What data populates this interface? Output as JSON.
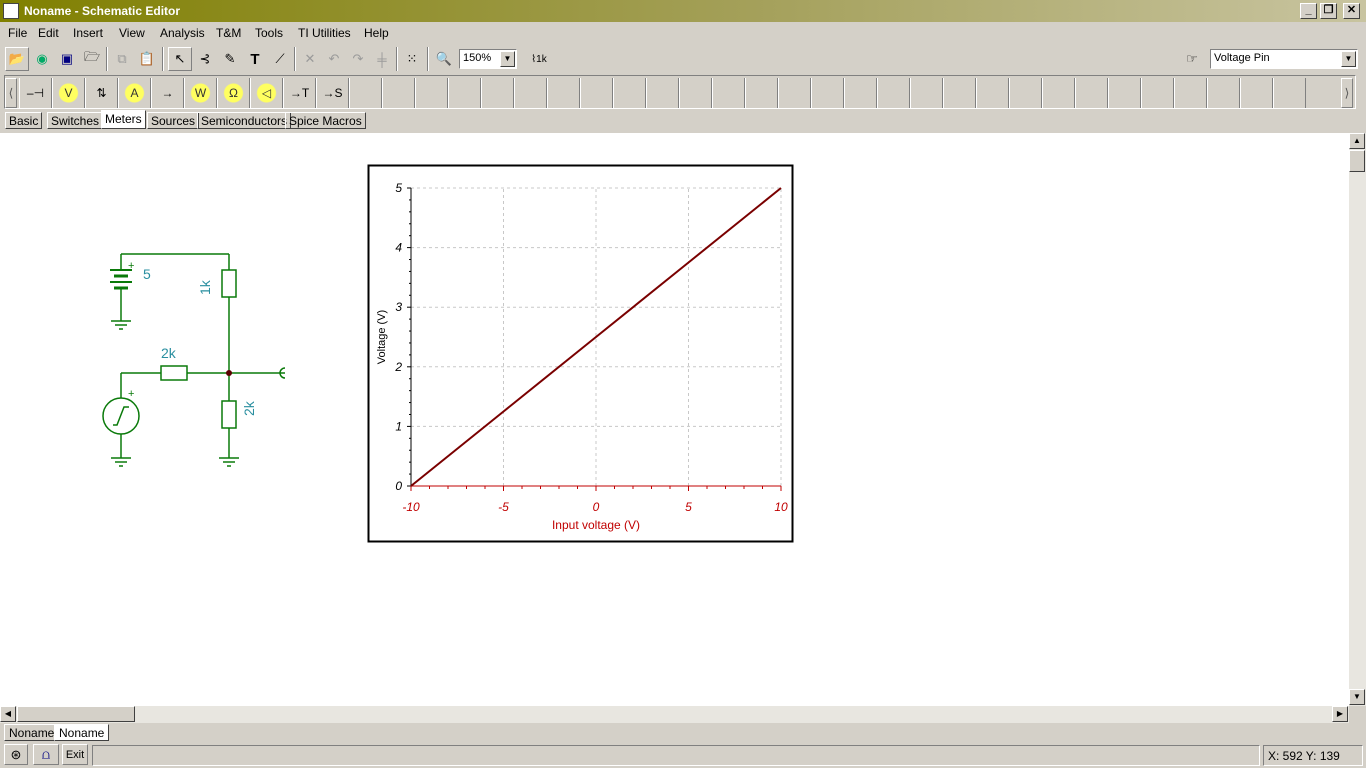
{
  "window": {
    "title": "Noname - Schematic Editor"
  },
  "menu": [
    "File",
    "Edit",
    "Insert",
    "View",
    "Analysis",
    "T&M",
    "Tools",
    "TI Utilities",
    "Help"
  ],
  "toolbar": {
    "zoom_value": "150%",
    "component_select": "Voltage Pin"
  },
  "palette": {
    "items": [
      {
        "icon": "voltage-pin-icon",
        "glyph": "–⊣"
      },
      {
        "icon": "voltmeter-icon",
        "glyph": "V"
      },
      {
        "icon": "voltage-arrow-icon",
        "glyph": "⇅"
      },
      {
        "icon": "ammeter-icon",
        "glyph": "A"
      },
      {
        "icon": "current-arrow-icon",
        "glyph": "→"
      },
      {
        "icon": "wattmeter-icon",
        "glyph": "W"
      },
      {
        "icon": "ohmmeter-icon",
        "glyph": "Ω"
      },
      {
        "icon": "speaker-icon",
        "glyph": "◁"
      },
      {
        "icon": "node-t-icon",
        "glyph": "→T"
      },
      {
        "icon": "node-s-icon",
        "glyph": "→S"
      }
    ]
  },
  "tabs": [
    "Basic",
    "Switches",
    "Meters",
    "Sources",
    "Semiconductors",
    "Spice Macros"
  ],
  "active_tab": "Meters",
  "schematic": {
    "battery_value": "5",
    "r_top": "1k",
    "r_series": "2k",
    "r_bottom": "2k",
    "plus_sign": "+"
  },
  "chart_data": {
    "type": "line",
    "xlabel": "Input voltage (V)",
    "ylabel": "Voltage (V)",
    "xlim": [
      -10,
      10
    ],
    "ylim": [
      0,
      5
    ],
    "x_ticks": [
      -10,
      -5,
      0,
      5,
      10
    ],
    "y_ticks": [
      0,
      1,
      2,
      3,
      4,
      5
    ],
    "grid": true,
    "series": [
      {
        "x": [
          -10,
          -5,
          0,
          5,
          10
        ],
        "y": [
          0,
          1.25,
          2.5,
          3.75,
          5
        ],
        "color": "#7a0000"
      }
    ]
  },
  "doc_tabs": [
    "Noname",
    "Noname"
  ],
  "status": {
    "exit_label": "Exit",
    "coords": "X: 592  Y: 139"
  }
}
